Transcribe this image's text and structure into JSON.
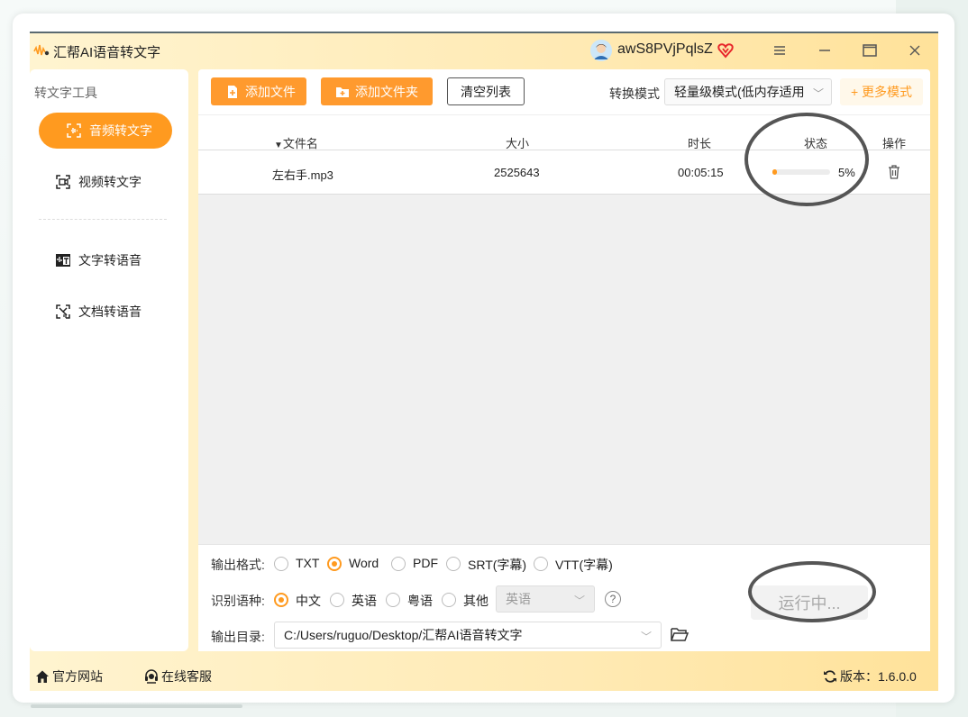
{
  "app": {
    "title": "汇帮AI语音转文字",
    "username": "awS8PVjPqlsZ"
  },
  "sidebar": {
    "section_title": "转文字工具",
    "items": [
      {
        "label": "音频转文字",
        "icon": "audio-to-text-icon",
        "active": true
      },
      {
        "label": "视频转文字",
        "icon": "video-to-text-icon",
        "active": false
      },
      {
        "label": "文字转语音",
        "icon": "text-to-speech-icon",
        "active": false
      },
      {
        "label": "文档转语音",
        "icon": "doc-to-speech-icon",
        "active": false
      }
    ]
  },
  "toolbar": {
    "add_file": "添加文件",
    "add_folder": "添加文件夹",
    "clear_list": "清空列表",
    "mode_label": "转换模式",
    "mode_value": "轻量级模式(低内存适用",
    "more_modes": "+ 更多模式"
  },
  "table": {
    "headers": {
      "name": "文件名",
      "size": "大小",
      "duration": "时长",
      "status": "状态",
      "action": "操作"
    },
    "rows": [
      {
        "name": "左右手.mp3",
        "size": "2525643",
        "duration": "00:05:15",
        "progress": 5,
        "progress_text": "5%"
      }
    ]
  },
  "settings": {
    "format_label": "输出格式:",
    "formats": [
      "TXT",
      "Word",
      "PDF",
      "SRT(字幕)",
      "VTT(字幕)"
    ],
    "format_selected": "Word",
    "lang_label": "识别语种:",
    "languages": [
      "中文",
      "英语",
      "粤语",
      "其他"
    ],
    "lang_selected": "中文",
    "other_lang_value": "英语",
    "help": "?",
    "dir_label": "输出目录:",
    "dir_value": "C:/Users/ruguo/Desktop/汇帮AI语音转文字",
    "run_label": "运行中..."
  },
  "footer": {
    "website": "官方网站",
    "support": "在线客服",
    "version": "版本：1.6.0.0"
  },
  "colors": {
    "accent": "#ff9a1f",
    "header_bg": "#ffeab4"
  }
}
